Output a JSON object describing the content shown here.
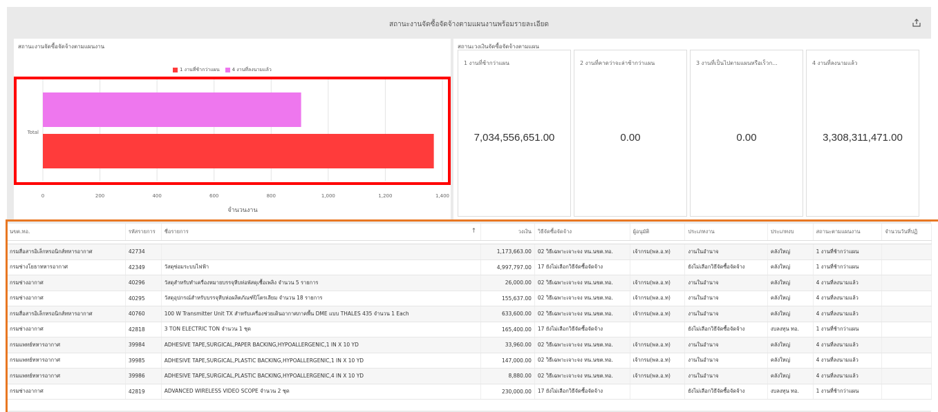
{
  "page": {
    "title": "สถานะงานจัดซื้อจัดจ้างตามแผนงานพร้อมรายละเอียด"
  },
  "chart_panel": {
    "title": "สถานะงานจัดซื้อจัดจ้างตามแผนงาน"
  },
  "chart_data": {
    "type": "bar",
    "orientation": "horizontal",
    "categories": [
      "Total"
    ],
    "series": [
      {
        "name": "1 งานที่ช้ากว่าแผน",
        "color": "#ff3b3b",
        "values": [
          1370
        ]
      },
      {
        "name": "4 งานที่ลงนามแล้ว",
        "color": "#ee77ee",
        "values": [
          905
        ]
      }
    ],
    "xlabel": "จำนวนงาน",
    "xlim": [
      0,
      1400
    ],
    "xticks": [
      "0",
      "200",
      "400",
      "600",
      "800",
      "1,000",
      "1,200",
      "1,400"
    ],
    "legend": "top",
    "grid": true
  },
  "kpi_panel": {
    "title": "สถานะวงเงินจัดซื้อจัดจ้างตามแผน"
  },
  "kpis": [
    {
      "label": "1 งานที่ช้ากว่าแผน",
      "value": "7,034,556,651.00"
    },
    {
      "label": "2 งานที่คาดว่าจะล่าช้ากว่าแผน",
      "value": "0.00"
    },
    {
      "label": "3 งานที่เป็นไปตามแผนหรือเร็วก...",
      "value": "0.00"
    },
    {
      "label": "4 งานที่ลงนามแล้ว",
      "value": "3,308,311,471.00"
    }
  ],
  "table": {
    "columns": [
      "นขต.ทอ.",
      "รหัสรายการ",
      "ชื่อรายการ",
      "วงเงิน",
      "วิธีจัดซื้อจัดจ้าง",
      "ผู้อนุมัติ",
      "ประเภทงาน",
      "ประเภทงบ",
      "สถานะตามแผนงาน",
      "จำนวนวันที่ปฏิ"
    ],
    "rows": [
      [
        "กรมสื่อสารอิเล็กทรอนิกส์ทหารอากาศ",
        "42734",
        "",
        "1,173,663.00",
        "02 วิธีเฉพาะเจาะจง หน.นขต.ทอ.",
        "เจ้ากรม(พล.อ.ท)",
        "งานในอำนาจ",
        "คลังใหญ่",
        "1 งานที่ช้ากว่าแผน",
        ""
      ],
      [
        "กรมช่างโยธาทหารอากาศ",
        "42349",
        "วัสดุซ่อมระบบไฟฟ้า",
        "4,997,797.00",
        "17 ยังไม่เลือกวิธีจัดซื้อจัดจ้าง",
        "",
        "ยังไม่เลือกวิธีจัดซื้อจัดจ้าง",
        "คลังใหญ่",
        "1 งานที่ช้ากว่าแผน",
        ""
      ],
      [
        "กรมช่างอากาศ",
        "40296",
        "วัสดุสำหรับทำเครื่องหมายบรรจุหีบห่อพัสดุเชื้อเพลิง จำนวน 5 รายการ",
        "26,000.00",
        "02 วิธีเฉพาะเจาะจง หน.นขต.ทอ.",
        "เจ้ากรม(พล.อ.ท)",
        "งานในอำนาจ",
        "คลังใหญ่",
        "4 งานที่ลงนามแล้ว",
        ""
      ],
      [
        "กรมช่างอากาศ",
        "40295",
        "วัสดุอุปกรณ์สำหรับบรรจุหีบห่อผลิตภัณฑ์ปิโตรเลียม จำนวน 18 รายการ",
        "155,637.00",
        "02 วิธีเฉพาะเจาะจง หน.นขต.ทอ.",
        "เจ้ากรม(พล.อ.ท)",
        "งานในอำนาจ",
        "คลังใหญ่",
        "4 งานที่ลงนามแล้ว",
        ""
      ],
      [
        "กรมสื่อสารอิเล็กทรอนิกส์ทหารอากาศ",
        "40760",
        "100 W Transmitter Unit TX สำหรับเครื่องช่วยเดินอากาศภาคพื้น DME แบบ THALES 435 จำนวน 1 Each",
        "633,600.00",
        "02 วิธีเฉพาะเจาะจง หน.นขต.ทอ.",
        "เจ้ากรม(พล.อ.ท)",
        "งานในอำนาจ",
        "คลังใหญ่",
        "4 งานที่ลงนามแล้ว",
        ""
      ],
      [
        "กรมช่างอากาศ",
        "42818",
        "3 TON ELECTRIC TON จำนวน 1 ชุด",
        "165,400.00",
        "17 ยังไม่เลือกวิธีจัดซื้อจัดจ้าง",
        "",
        "ยังไม่เลือกวิธีจัดซื้อจัดจ้าง",
        "งบลงทุน ทอ.",
        "1 งานที่ช้ากว่าแผน",
        ""
      ],
      [
        "กรมแพทย์ทหารอากาศ",
        "39984",
        "ADHESIVE TAPE,SURGICAL,PAPER BACKING,HYPOALLERGENIC,1 IN X 10 YD",
        "33,960.00",
        "02 วิธีเฉพาะเจาะจง หน.นขต.ทอ.",
        "เจ้ากรม(พล.อ.ท)",
        "งานในอำนาจ",
        "คลังใหญ่",
        "4 งานที่ลงนามแล้ว",
        ""
      ],
      [
        "กรมแพทย์ทหารอากาศ",
        "39985",
        "ADHESIVE TAPE,SURGICAL,PLASTIC BACKING,HYPOALLERGENIC,1 IN X 10 YD",
        "147,000.00",
        "02 วิธีเฉพาะเจาะจง หน.นขต.ทอ.",
        "เจ้ากรม(พล.อ.ท)",
        "งานในอำนาจ",
        "คลังใหญ่",
        "4 งานที่ลงนามแล้ว",
        ""
      ],
      [
        "กรมแพทย์ทหารอากาศ",
        "39986",
        "ADHESIVE TAPE,SURGICAL,PLASTIC BACKING,HYPOALLERGENIC,4 IN X 10 YD",
        "8,880.00",
        "02 วิธีเฉพาะเจาะจง หน.นขต.ทอ.",
        "เจ้ากรม(พล.อ.ท)",
        "งานในอำนาจ",
        "คลังใหญ่",
        "4 งานที่ลงนามแล้ว",
        ""
      ],
      [
        "กรมช่างอากาศ",
        "42819",
        "ADVANCED WIRELESS VIDEO SCOPE จำนวน 2 ชุด",
        "230,000.00",
        "17 ยังไม่เลือกวิธีจัดซื้อจัดจ้าง",
        "",
        "ยังไม่เลือกวิธีจัดซื้อจัดจ้าง",
        "งบลงทุน ทอ.",
        "1 งานที่ช้ากว่าแผน",
        ""
      ]
    ]
  },
  "colors": {
    "highlight_chart": "#ff0000",
    "highlight_table": "#e87722"
  }
}
